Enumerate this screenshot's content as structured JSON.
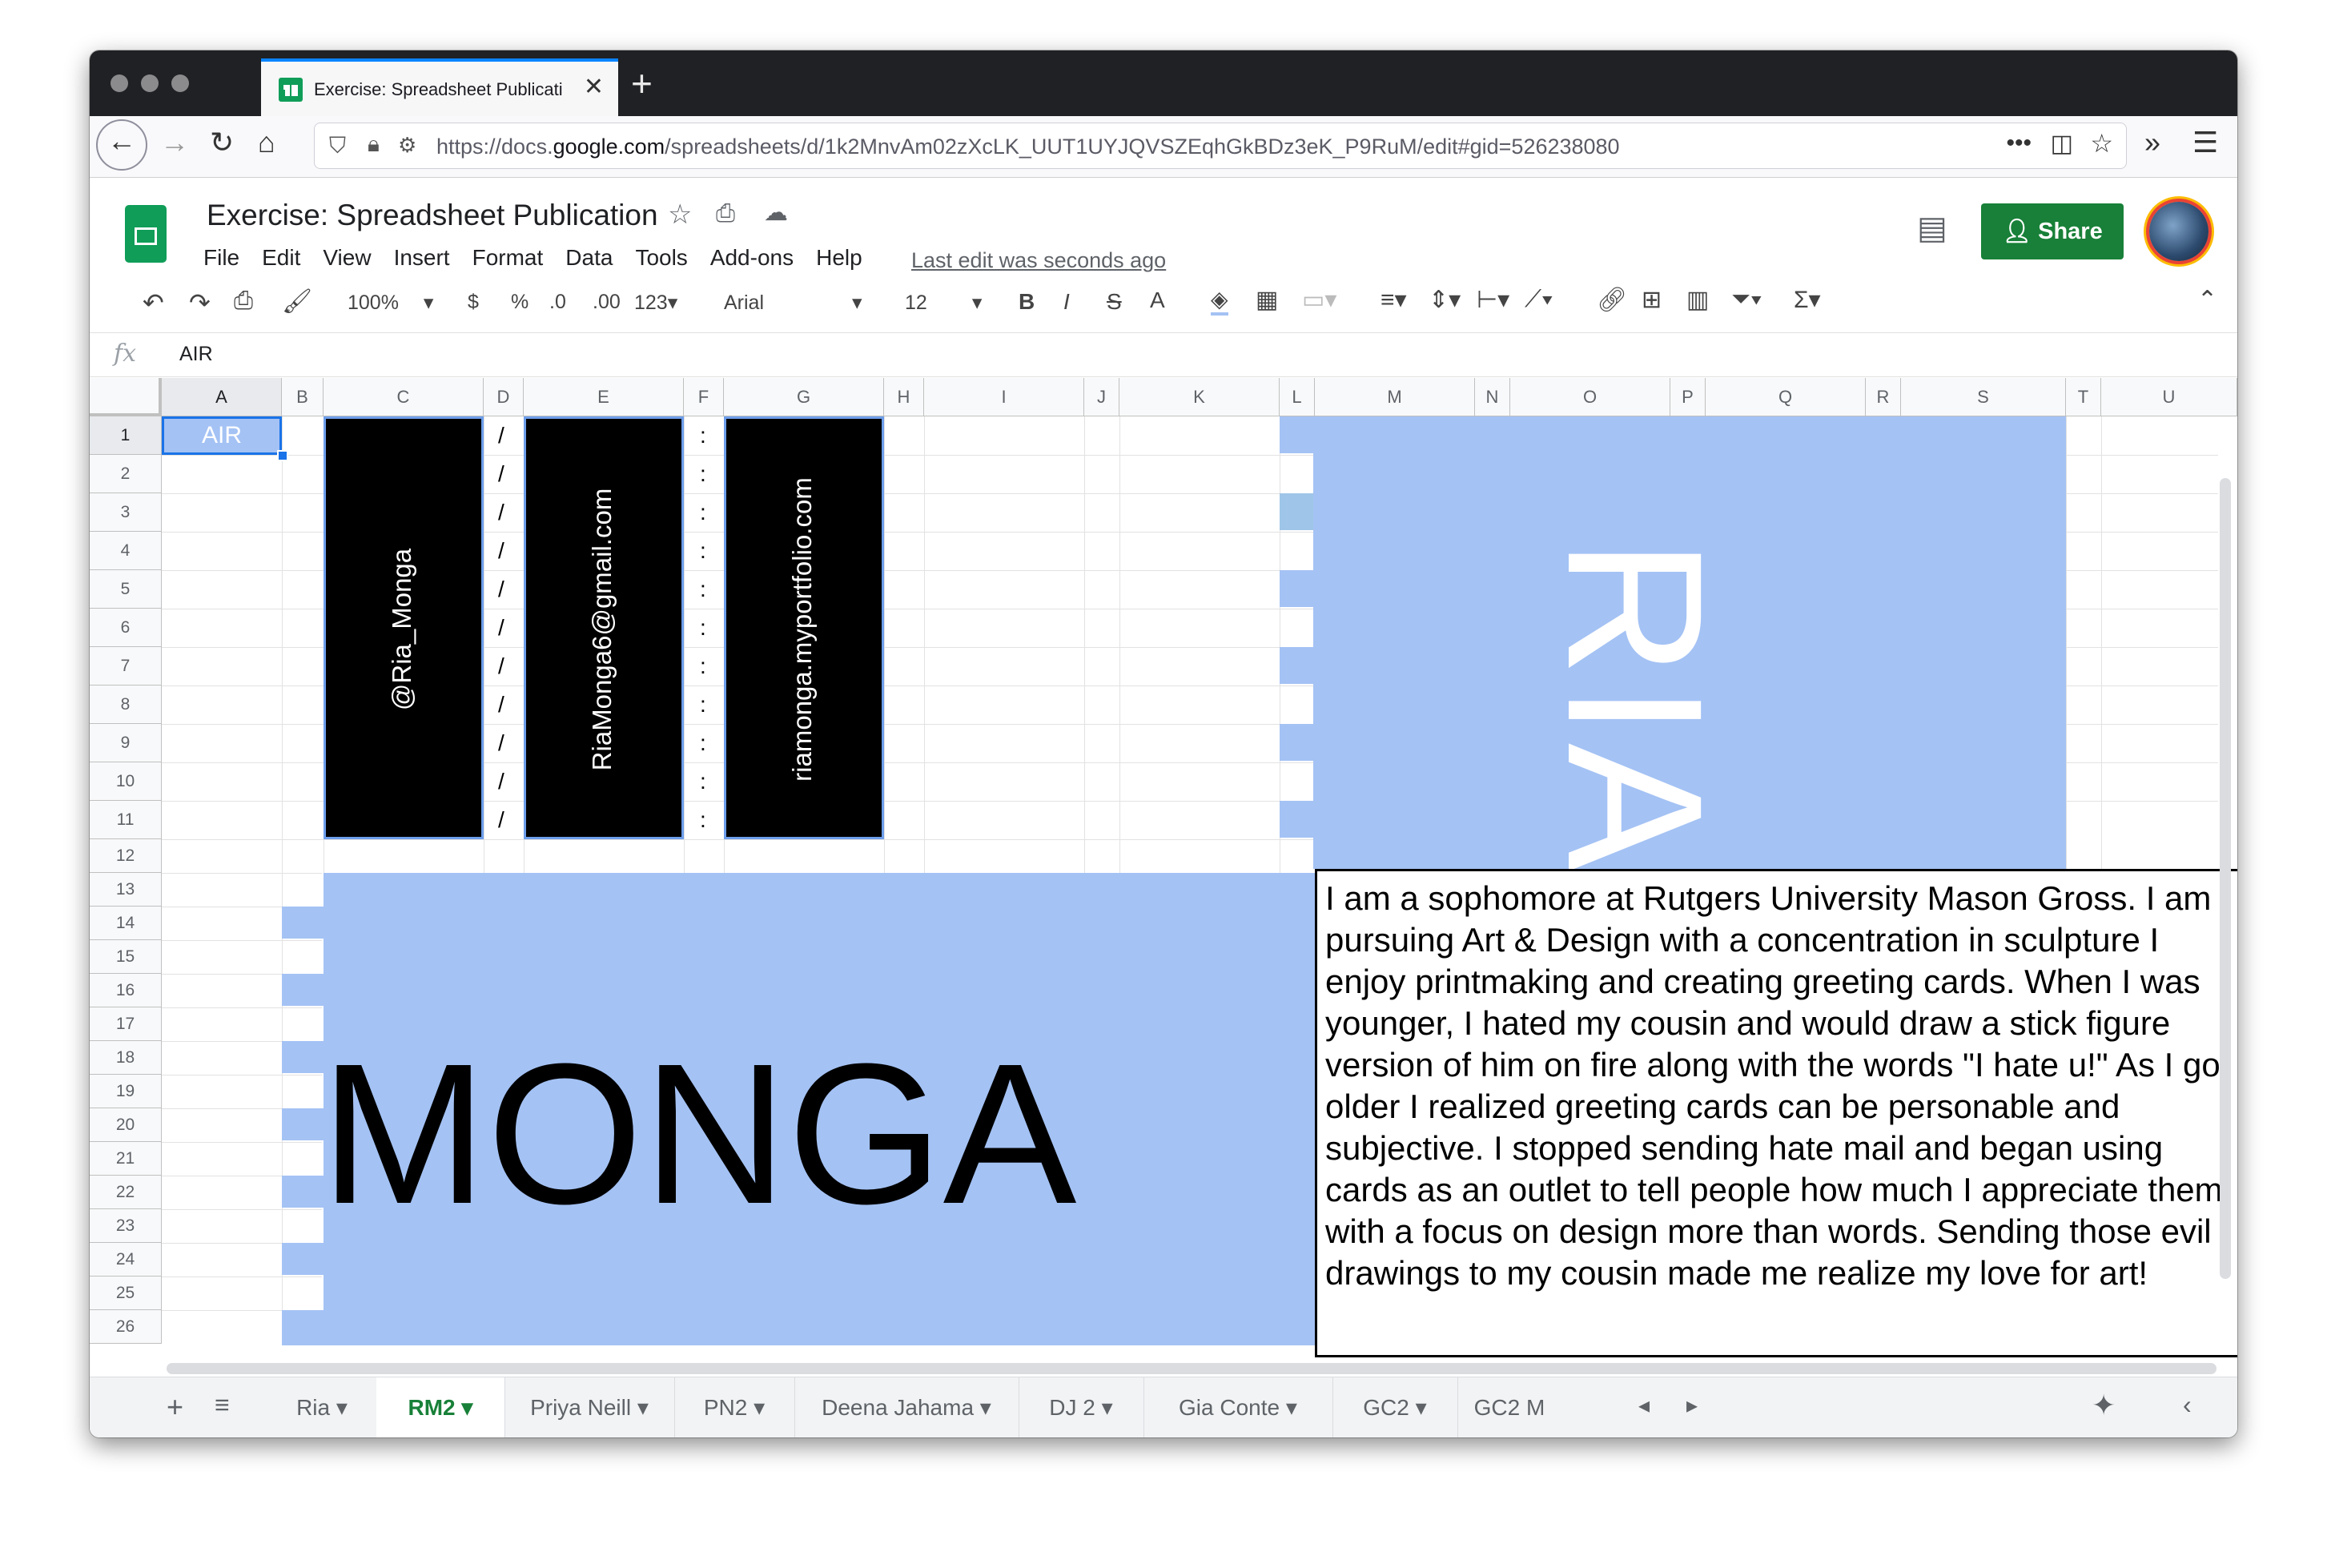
{
  "browser": {
    "tab_title": "Exercise: Spreadsheet Publicati",
    "url_prefix": "https://docs.",
    "url_domain": "google.com",
    "url_path": "/spreadsheets/d/1k2MnvAm02zXcLK_UUT1UYJQVSZEqhGkBDz3eK_P9RuM/edit#gid=526238080"
  },
  "doc": {
    "title": "Exercise: Spreadsheet Publication",
    "menu": [
      "File",
      "Edit",
      "View",
      "Insert",
      "Format",
      "Data",
      "Tools",
      "Add-ons",
      "Help"
    ],
    "last_edit": "Last edit was seconds ago",
    "share_label": "Share"
  },
  "toolbar": {
    "zoom": "100%",
    "currency": "$",
    "percent": "%",
    "dec_less": ".0",
    "dec_more": ".00",
    "format_more": "123",
    "font": "Arial",
    "font_size": "12",
    "bold": "B",
    "italic": "I",
    "strike": "S",
    "text_color": "A"
  },
  "formula": {
    "fx": "fx",
    "value": "AIR"
  },
  "columns": [
    "A",
    "B",
    "C",
    "D",
    "E",
    "F",
    "G",
    "H",
    "I",
    "J",
    "K",
    "L",
    "M",
    "N",
    "O",
    "P",
    "Q",
    "R",
    "S",
    "T",
    "U"
  ],
  "rows": [
    "1",
    "2",
    "3",
    "4",
    "5",
    "6",
    "7",
    "8",
    "9",
    "10",
    "11",
    "12",
    "13",
    "14",
    "15",
    "16",
    "17",
    "18",
    "19",
    "20",
    "21",
    "22",
    "23",
    "24",
    "25",
    "26"
  ],
  "cells": {
    "a1": "AIR",
    "handle": "@Ria_Monga",
    "email": "RiaMonga6@gmail.com",
    "site": "riamonga.myportfolio.com",
    "slash": "/",
    "colon": ":",
    "ria": "RIA",
    "monga": "MONGA",
    "bio": "I am a sophomore at Rutgers University Mason Gross. I am pursuing Art & Design with a concentration in sculpture I enjoy printmaking and creating greeting cards. When I was younger, I hated my cousin and would draw a stick figure version of him on fire along with the words \"I hate u!\" As I got older I realized greeting cards can be personable and subjective. I stopped sending hate mail and began using cards as an outlet to tell people how much I appreciate them with a focus on design more than words. Sending those evil drawings to my cousin made me realize my love for art!"
  },
  "sheet_tabs": [
    "Ria",
    "RM2",
    "Priya Neill",
    "PN2",
    "Deena Jahama",
    "DJ 2",
    "Gia Conte",
    "GC2",
    "GC2 M"
  ],
  "active_tab": "RM2",
  "colors": {
    "accent_green": "#188038",
    "cell_blue": "#a4c2f4",
    "selection": "#1a73e8"
  }
}
